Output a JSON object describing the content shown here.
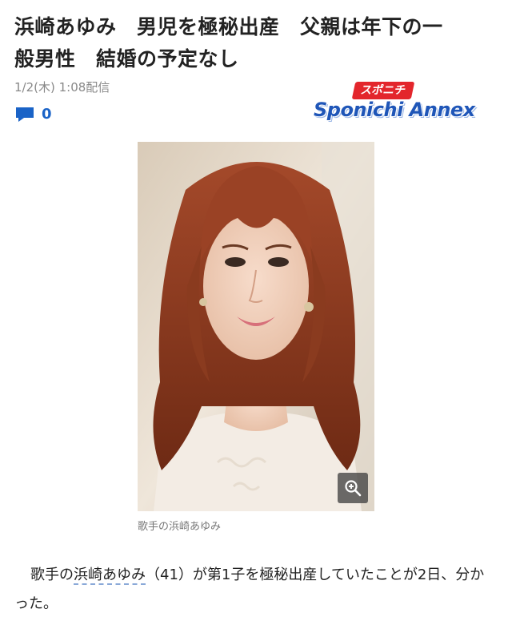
{
  "article": {
    "headline_line1": "浜崎あゆみ　男児を極秘出産　父親は年下の一",
    "headline_line2": "般男性　結婚の予定なし",
    "date": "1/2(木) 1:08配信",
    "comment_count": "0",
    "publisher": {
      "logo_top": "スポニチ",
      "logo_main": "Sponichi Annex"
    },
    "photo": {
      "caption": "歌手の浜崎あゆみ",
      "zoom_icon": "zoom-in-icon"
    },
    "body": {
      "prefix": "歌手の",
      "linked_name": "浜崎あゆみ",
      "suffix": "（41）が第1子を極秘出産していたことが2日、分かった。"
    }
  },
  "colors": {
    "accent_blue": "#1a63c7",
    "logo_red": "#e3262c",
    "hair": "#8a3b1f"
  }
}
